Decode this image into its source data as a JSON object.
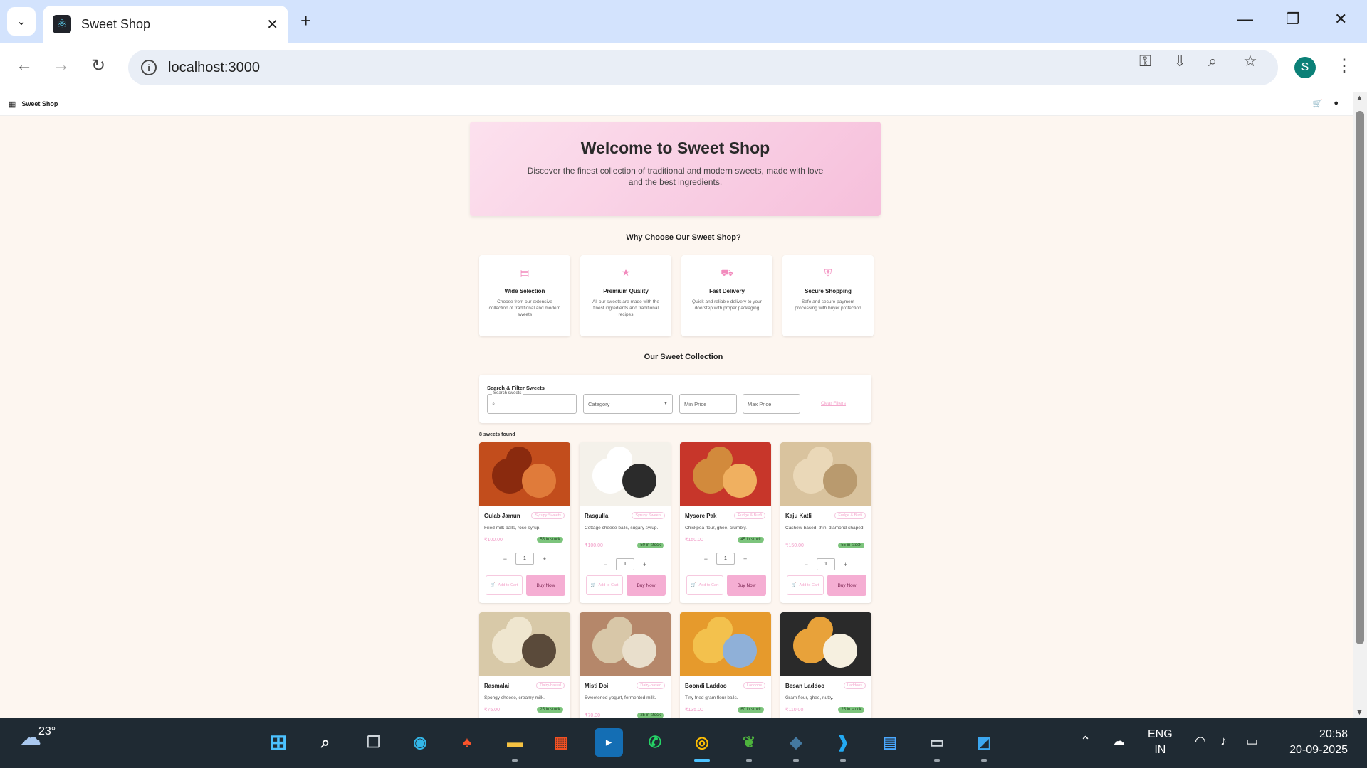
{
  "browser": {
    "tab_title": "Sweet Shop",
    "url": "localhost:3000",
    "profile_initial": "S"
  },
  "app": {
    "brand": "Sweet Shop"
  },
  "hero": {
    "title": "Welcome to Sweet Shop",
    "subtitle": "Discover the finest collection of traditional and modern sweets, made with love and the best ingredients."
  },
  "why": {
    "title": "Why Choose Our Sweet Shop?",
    "features": [
      {
        "icon": "store-icon",
        "title": "Wide Selection",
        "desc": "Choose from our extensive collection of traditional and modern sweets"
      },
      {
        "icon": "star-icon",
        "title": "Premium Quality",
        "desc": "All our sweets are made with the finest ingredients and traditional recipes"
      },
      {
        "icon": "truck-icon",
        "title": "Fast Delivery",
        "desc": "Quick and reliable delivery to your doorstep with proper packaging"
      },
      {
        "icon": "shield-icon",
        "title": "Secure Shopping",
        "desc": "Safe and secure payment processing with buyer protection"
      }
    ]
  },
  "collection": {
    "title": "Our Sweet Collection"
  },
  "filters": {
    "title": "Search & Filter Sweets",
    "search_legend": "Search sweets",
    "category_placeholder": "Category",
    "min_price_placeholder": "Min Price",
    "max_price_placeholder": "Max Price",
    "clear_label": "Clear Filters"
  },
  "results_count": "8 sweets found",
  "card_labels": {
    "add_to_cart": "Add to Cart",
    "buy_now": "Buy Now",
    "qty": "1"
  },
  "products": [
    {
      "name": "Gulab Jamun",
      "category": "Syrupy Sweets",
      "desc": "Fried milk balls, rose syrup.",
      "price": "₹100.00",
      "stock": "55 in stock"
    },
    {
      "name": "Rasgulla",
      "category": "Syrupy Sweets",
      "desc": "Cottage cheese balls, sugary syrup.",
      "price": "₹100.00",
      "stock": "50 in stock"
    },
    {
      "name": "Mysore Pak",
      "category": "Fudge & Burfi",
      "desc": "Chickpea flour, ghee, crumbly.",
      "price": "₹150.00",
      "stock": "45 in stock"
    },
    {
      "name": "Kaju Katli",
      "category": "Fudge & Burfi",
      "desc": "Cashew-based, thin, diamond-shaped.",
      "price": "₹150.00",
      "stock": "55 in stock"
    },
    {
      "name": "Rasmalai",
      "category": "Dairy-based",
      "desc": "Spongy cheese, creamy milk.",
      "price": "₹75.00",
      "stock": "25 in stock"
    },
    {
      "name": "Misti Doi",
      "category": "Dairy-based",
      "desc": "Sweetened yogurt, fermented milk.",
      "price": "₹70.00",
      "stock": "25 in stock"
    },
    {
      "name": "Boondi Laddoo",
      "category": "Laddoos",
      "desc": "Tiny fried gram flour balls.",
      "price": "₹135.00",
      "stock": "60 in stock"
    },
    {
      "name": "Besan Laddoo",
      "category": "Laddoos",
      "desc": "Gram flour, ghee, nutty.",
      "price": "₹110.00",
      "stock": "25 in stock"
    }
  ],
  "taskbar": {
    "temperature": "23°",
    "lang_line1": "ENG",
    "lang_line2": "IN",
    "time": "20:58",
    "date": "20-09-2025"
  }
}
